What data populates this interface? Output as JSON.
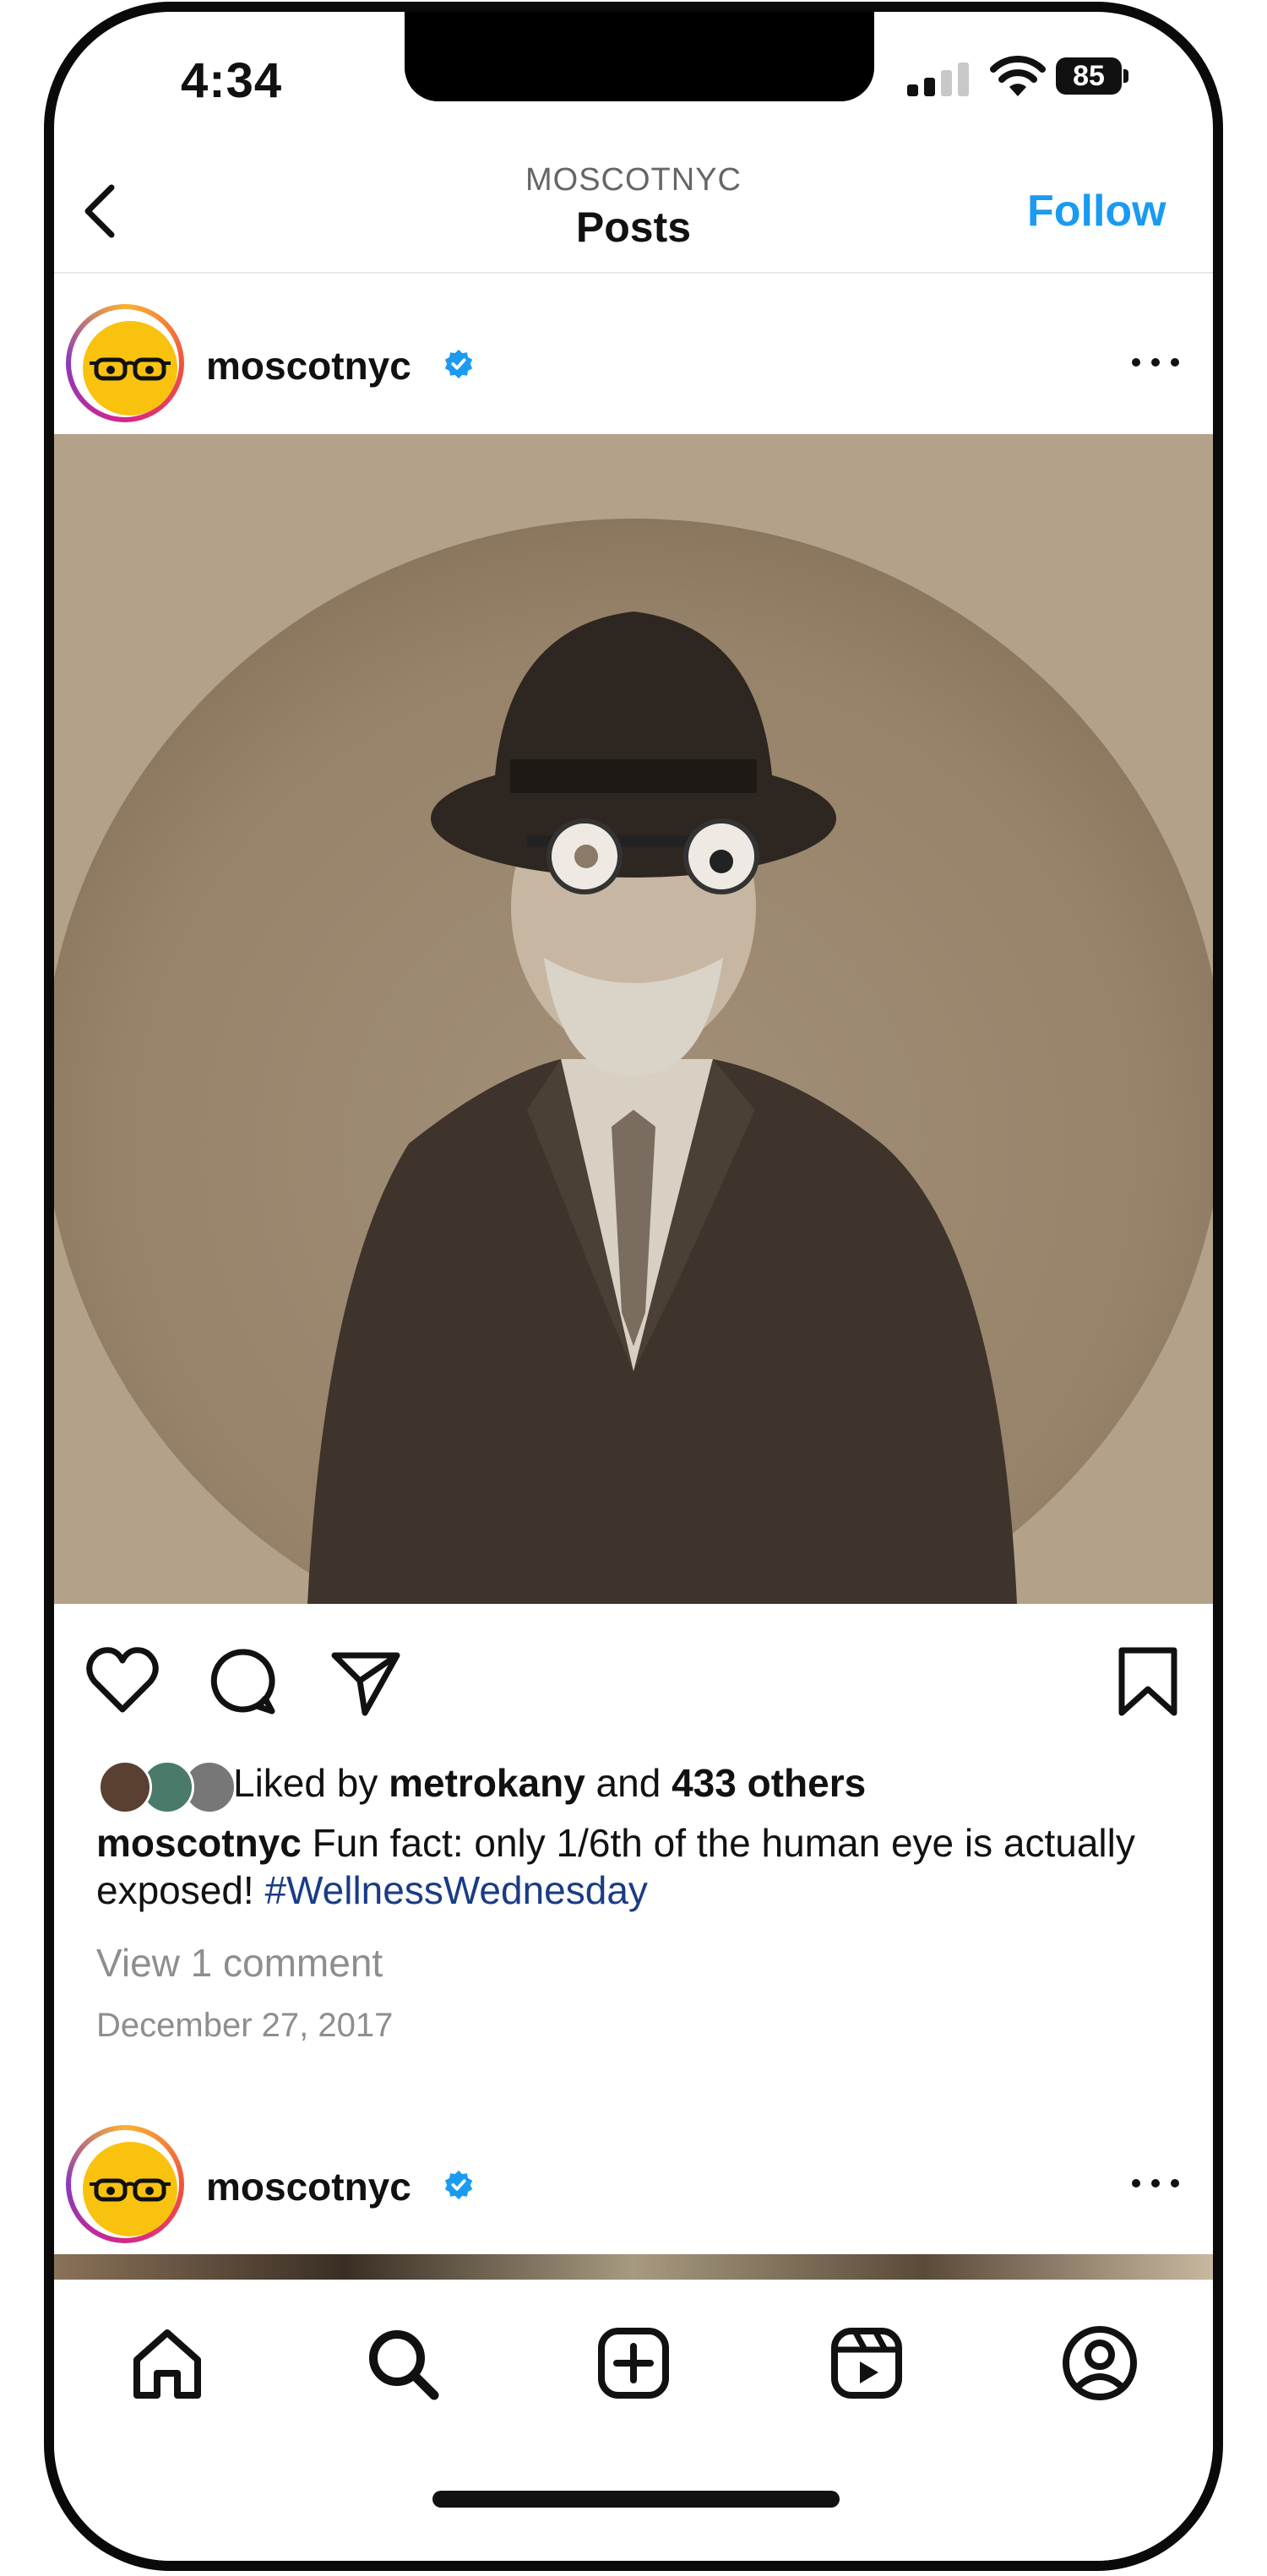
{
  "status_bar": {
    "time": "4:34",
    "battery": "85"
  },
  "header": {
    "account": "MOSCOTNYC",
    "title": "Posts",
    "follow_label": "Follow"
  },
  "post": {
    "username": "moscotnyc",
    "liked_by_prefix": "Liked by ",
    "liked_by_user": "metrokany",
    "liked_by_connector": " and ",
    "liked_by_others": "433 others",
    "caption_user": "moscotnyc",
    "caption_text": " Fun fact: only 1/6th of the human eye is actually exposed! ",
    "hashtag": "#WellnessWednesday",
    "view_comments": "View 1 comment",
    "date": "December 27, 2017"
  },
  "next_post": {
    "username": "moscotnyc"
  },
  "tab_bar": {
    "items": [
      "home",
      "search",
      "create",
      "reels",
      "profile"
    ]
  },
  "colors": {
    "accent": "#1a9bf0",
    "hashtag": "#1a3c86",
    "verified": "#1a9bf0",
    "avatar": "#f9c20e"
  }
}
